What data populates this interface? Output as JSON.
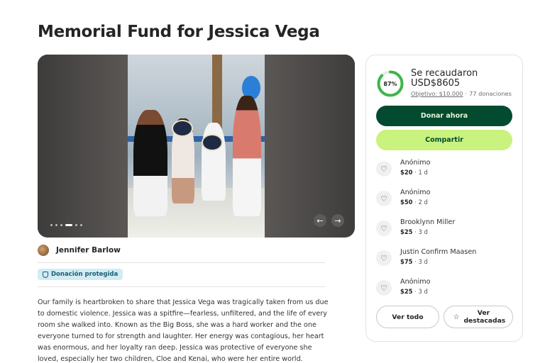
{
  "page": {
    "title": "Memorial Fund for Jessica Vega"
  },
  "gallery": {
    "slides_total": 6,
    "active_slide": 4
  },
  "organizer": {
    "name": "Jennifer Barlow"
  },
  "badge": {
    "label": "Donación protegida"
  },
  "story": {
    "text": "Our family is heartbroken to share that Jessica Vega was tragically taken from us due to domestic violence. Jessica was a spitfire—fearless, unfiltered, and the life of every room she walked into. Known as the Big Boss, she was a hard worker and the one everyone turned to for strength and laughter. Her energy was contagious, her heart was enormous, and her loyalty ran deep. Jessica was protective of everyone she loved, especially her two children, Cloe and Kenai, who were her entire world."
  },
  "summary": {
    "progress_label": "87%",
    "progress_fraction": 0.87,
    "raised_label": "Se recaudaron",
    "raised_amount": "USD$8605",
    "goal_label": "Objetivo: $10.000",
    "donations_count": "77 donaciones",
    "donate_button": "Donar ahora",
    "share_button": "Compartir",
    "see_all_button": "Ver todo",
    "top_button": "Ver destacadas"
  },
  "colors": {
    "accent_dark": "#024b30",
    "accent_light": "#c9f27e",
    "ring_fill": "#3fb54b",
    "badge_bg": "#d2ecf4"
  },
  "donations": [
    {
      "name": "Anónimo",
      "amount": "$20",
      "time": "1 d"
    },
    {
      "name": "Anónimo",
      "amount": "$50",
      "time": "2 d"
    },
    {
      "name": "Brooklynn Miller",
      "amount": "$25",
      "time": "3 d"
    },
    {
      "name": "Justin Confirm Maasen",
      "amount": "$75",
      "time": "3 d"
    },
    {
      "name": "Anónimo",
      "amount": "$25",
      "time": "3 d"
    }
  ]
}
